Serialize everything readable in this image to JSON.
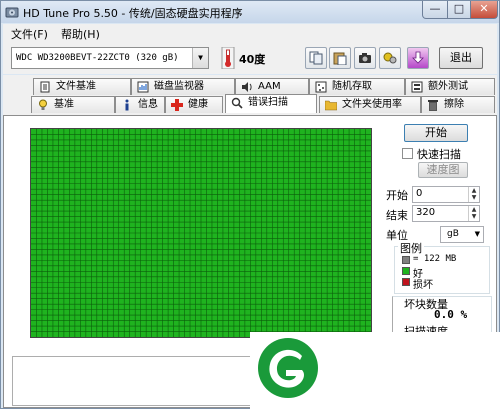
{
  "window": {
    "title": "HD Tune Pro 5.50 - 传统/固态硬盘实用程序"
  },
  "window_controls": {
    "minimize": "—",
    "maximize": "□",
    "close": "✕"
  },
  "menu": [
    {
      "label": "文件(F)"
    },
    {
      "label": "帮助(H)"
    }
  ],
  "toolbar": {
    "drive": "WDC WD3200BEVT-22ZCT0 (320 gB)",
    "temperature": "40度",
    "exit_label": "退出",
    "icons": [
      "copy-icon",
      "paste-icon",
      "camera-icon",
      "options-icon",
      "download-icon"
    ]
  },
  "tabs_row1": [
    {
      "label": "文件基准",
      "icon": "file-benchmark-icon"
    },
    {
      "label": "磁盘监视器",
      "icon": "disk-monitor-icon"
    },
    {
      "label": "AAM",
      "icon": "speaker-icon"
    },
    {
      "label": "随机存取",
      "icon": "random-access-icon"
    },
    {
      "label": "额外测试",
      "icon": "extra-tests-icon"
    }
  ],
  "tabs_row2": [
    {
      "label": "基准",
      "icon": "benchmark-icon"
    },
    {
      "label": "信息",
      "icon": "info-icon"
    },
    {
      "label": "健康",
      "icon": "health-icon"
    },
    {
      "label": "错误扫描",
      "icon": "error-scan-icon",
      "active": true
    },
    {
      "label": "文件夹使用率",
      "icon": "folder-icon"
    },
    {
      "label": "擦除",
      "icon": "erase-icon"
    }
  ],
  "scan": {
    "start_button": "开始",
    "quick_scan_label": "快速扫描",
    "quick_scan_checked": false,
    "speed_map_button": "速度图",
    "start_label": "开始",
    "start_value": "0",
    "end_label": "结束",
    "end_value": "320",
    "unit_label": "单位",
    "unit_value": "gB",
    "legend_title": "图例",
    "legend": [
      {
        "text": "= 122 MB",
        "color": "#808080"
      },
      {
        "text": "好",
        "color": "#1fb31f"
      },
      {
        "text": "损坏",
        "color": "#c0141e"
      }
    ],
    "bad_blocks_label": "坏块数量",
    "bad_blocks_value": "0.0 %",
    "scan_speed_label": "扫描速度",
    "block_color": "#1fb31f",
    "grid_line_color": "#0b5e0b",
    "map_rows": 38,
    "map_cols": 62
  },
  "logo": {
    "color": "#1a9a3a"
  }
}
